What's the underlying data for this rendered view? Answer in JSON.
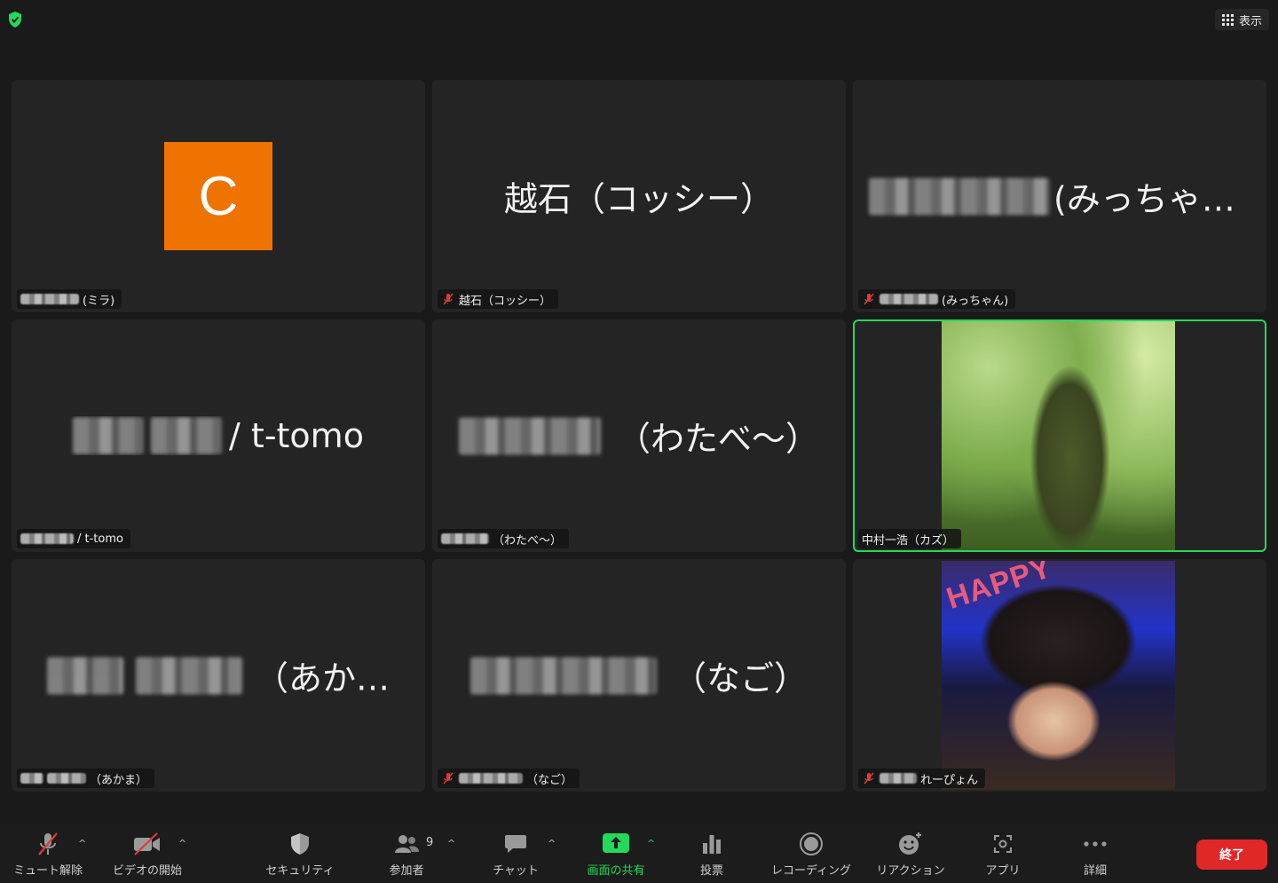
{
  "topbar": {
    "view_label": "表示"
  },
  "tiles": [
    {
      "big_text": "",
      "label_suffix": "(ミラ)"
    },
    {
      "big_text": "越石（コッシー）",
      "label_suffix": "越石（コッシー）"
    },
    {
      "big_text": "(みっちゃ…",
      "label_suffix": "(みっちゃん)"
    },
    {
      "big_text": "/ t-tomo",
      "label_suffix": "/ t-tomo"
    },
    {
      "big_text": "（わたべ〜）",
      "label_suffix": "（わたべ〜）"
    },
    {
      "big_text": "",
      "label_suffix": "中村一浩（カズ）"
    },
    {
      "big_text": "（あか…",
      "label_suffix": "（あかま）"
    },
    {
      "big_text": "（なご）",
      "label_suffix": "（なご）"
    },
    {
      "big_text": "",
      "label_suffix": "れーぴょん"
    }
  ],
  "avatar": {
    "letter": "C",
    "color": "#ee7300"
  },
  "camera": {
    "party_sign": "HAPPY"
  },
  "toolbar": {
    "mute_label": "ミュート解除",
    "video_label": "ビデオの開始",
    "security_label": "セキュリティ",
    "participants_label": "参加者",
    "participants_count": "9",
    "chat_label": "チャット",
    "share_label": "画面の共有",
    "poll_label": "投票",
    "record_label": "レコーディング",
    "reaction_label": "リアクション",
    "apps_label": "アプリ",
    "more_label": "詳細",
    "end_label": "終了"
  },
  "colors": {
    "active_speaker": "#23d959",
    "end_button": "#e02828",
    "share_icon": "#23d959"
  }
}
